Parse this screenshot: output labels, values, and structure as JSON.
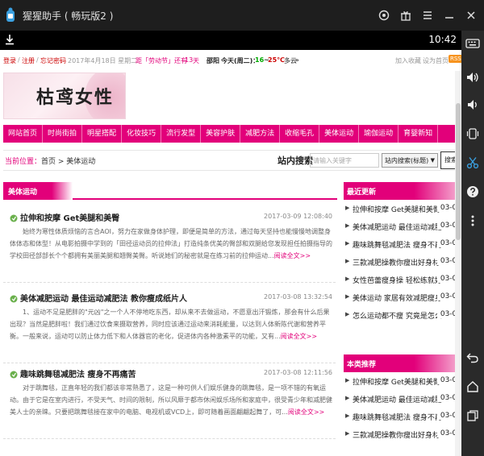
{
  "window": {
    "title": "猩猩助手 ( 畅玩版2 )"
  },
  "statusbar": {
    "clock": "10:42"
  },
  "top": {
    "login": "登录",
    "register": "注册",
    "forgot": "忘记密码",
    "sep1": "/",
    "sep2": "/",
    "date": "2017年4月18日 星期二",
    "countdown_prefix": "距「劳动节」还有",
    "countdown_days": "13",
    "countdown_suffix": "天",
    "city": "邵阳",
    "weather_day": "今天(周二)：",
    "temp_low": "16",
    "temp_sep": "~",
    "temp_high": "25℃",
    "weather_desc": "多云",
    "weather_more": "»",
    "fav": "加入收藏",
    "home": "设为首页",
    "rss": "RSS"
  },
  "banner": {
    "title": "枯鸢女性"
  },
  "nav": [
    "网站首页",
    "时尚街拍",
    "明星搭配",
    "化妆技巧",
    "流行发型",
    "美容护肤",
    "减肥方法",
    "收缩毛孔",
    "美体运动",
    "瑜伽运动",
    "育婴新知"
  ],
  "crumb": {
    "label": "当前位置：",
    "path": "首页 > 美体运动"
  },
  "search": {
    "label": "站内搜索",
    "placeholder": "请输入关键字",
    "select": "站内搜索(标题)",
    "button": "搜索"
  },
  "section": {
    "title": "美体运动"
  },
  "articles": [
    {
      "title": "拉伸和按摩 Get美腿和美臀",
      "date": "2017-03-09 12:08:40",
      "text": "　　始终为寒性体质烦恼的言合AOI，努力在家做身体护理，即便是简单的方法，通过每天坚持也能慢慢地调整身体体态和体型！从电影拍摄中学到的「田径运动员的拉伸法」打造纯条优美的臀部和双腿给您发现担任拍摄指导的学校田径部部长个个都拥有美丽美腿和翘臀美臀。听说她们的秘密就是在练习前的拉伸运动...",
      "more": "阅读全文>>"
    },
    {
      "title": "美体减肥运动 最佳运动减肥法 教你瘦成纸片人",
      "date": "2017-03-08 13:32:54",
      "text": "　　1、运动不足是肥胖的\"元凶\"之一个人不停地吃东西，却从来不去做运动，不愿意出汗锻炼，那会有什么后果出现？当然是肥胖啦！我们通过饮食来摄取营养，同时应该通过运动来消耗能量，以达到人体新陈代谢和营养平衡。一般来说，运动可以防止体力低下和人体器官的老化，促进体内各种激素平的功能，又有...",
      "more": "阅读全文>>"
    },
    {
      "title": "趣味跳舞毯减肥法 瘦身不再痛苦",
      "date": "2017-03-08 12:11:56",
      "text": "　　对于跳舞毯，正直年轻的我们都该非常熟悉了，这是一种可供人们娱乐健身的跳舞毯，是一项不错的有氧运动。由于它是在室内进行，不受天气、时间的限制，所以风靡于都市休闲娱乐场所和家庭中，很受青少年和减肥健美人士的亲睐。只要把跳舞毯接在家中的电脑、电视机或VCD上，即可随着画面翩翩起舞了，可...",
      "more": "阅读全文>>"
    }
  ],
  "recent": {
    "title": "最近更新",
    "items": [
      {
        "text": "拉伸和按摩 Get美腿和美臀",
        "date": "03-09"
      },
      {
        "text": "美体减肥运动 最佳运动减肥",
        "date": "03-08"
      },
      {
        "text": "趣味跳舞毯减肥法 瘦身不再",
        "date": "03-08"
      },
      {
        "text": "三款减肥操教你瘦出好身材",
        "date": "03-07"
      },
      {
        "text": "女性芭蕾瘦身操 轻松练就好",
        "date": "03-07"
      },
      {
        "text": "美体运动 家居有效减肥瘦身",
        "date": "03-06"
      },
      {
        "text": "怎么运动都不瘦 究竟是怎么",
        "date": "03-06"
      }
    ]
  },
  "recommend": {
    "title": "本类推荐",
    "items": [
      {
        "text": "拉伸和按摩 Get美腿和美臀",
        "date": "03-09"
      },
      {
        "text": "美体减肥运动 最佳运动减肥",
        "date": "03-08"
      },
      {
        "text": "趣味跳舞毯减肥法 瘦身不再",
        "date": "03-08"
      },
      {
        "text": "三款减肥操教你瘦出好身材",
        "date": "03-07"
      }
    ]
  },
  "colors": {
    "accent": "#e2007a",
    "titlebar": "#1e1e1e",
    "statusbar": "#000000",
    "toolbar": "#2a2a2a"
  },
  "icons": {
    "window": [
      "record-icon",
      "gift-icon",
      "menu-icon",
      "minimize-icon",
      "close-icon"
    ],
    "toolbar": [
      "keyboard-icon",
      "volume-up-icon",
      "volume-down-icon",
      "shake-icon",
      "screenshot-icon",
      "help-icon",
      "more-icon",
      "back-icon",
      "home-icon",
      "recent-apps-icon"
    ]
  }
}
